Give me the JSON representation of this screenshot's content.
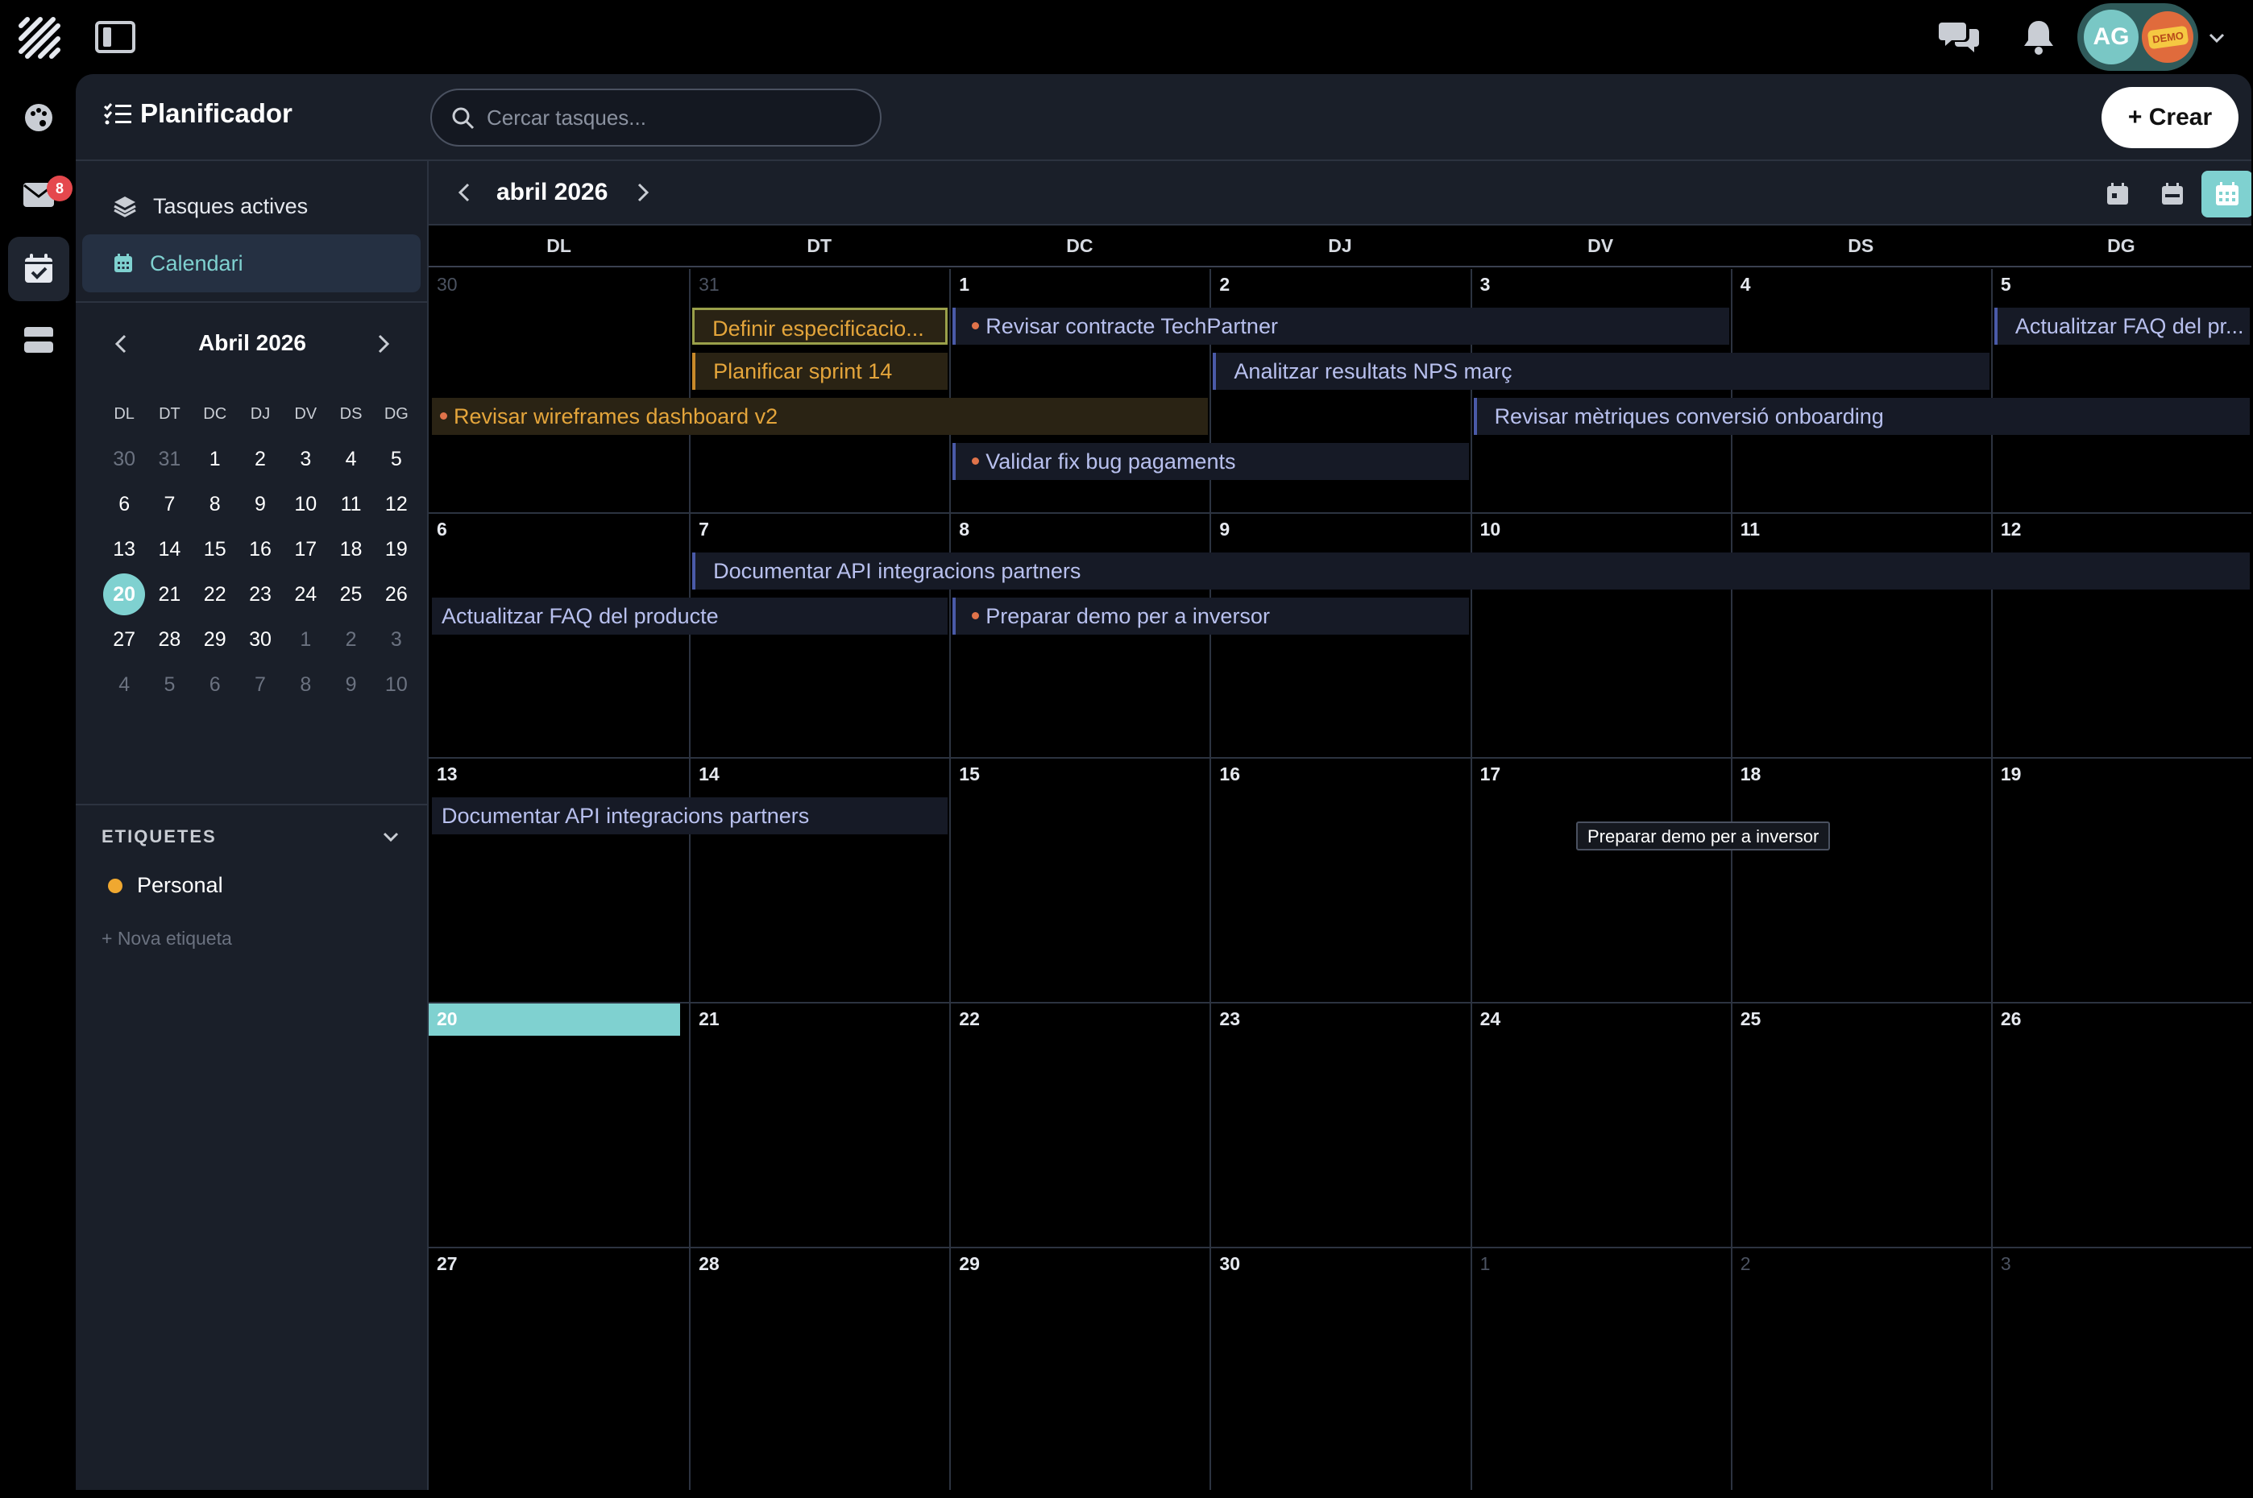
{
  "app": {
    "title": "Planificador",
    "create_label": "+ Crear",
    "user_initials": "AG",
    "demo_label": "DEMO",
    "inbox_badge": "8"
  },
  "search": {
    "placeholder": "Cercar tasques..."
  },
  "sidebar": {
    "items": [
      {
        "label": "Tasques actives",
        "icon": "layers-icon"
      },
      {
        "label": "Calendari",
        "icon": "calendar-icon",
        "active": true
      }
    ]
  },
  "mini_calendar": {
    "title": "Abril 2026",
    "weekdays": [
      "DL",
      "DT",
      "DC",
      "DJ",
      "DV",
      "DS",
      "DG"
    ],
    "weeks": [
      [
        {
          "d": "30",
          "dim": true
        },
        {
          "d": "31",
          "dim": true
        },
        {
          "d": "1"
        },
        {
          "d": "2"
        },
        {
          "d": "3"
        },
        {
          "d": "4"
        },
        {
          "d": "5"
        }
      ],
      [
        {
          "d": "6"
        },
        {
          "d": "7"
        },
        {
          "d": "8"
        },
        {
          "d": "9"
        },
        {
          "d": "10"
        },
        {
          "d": "11"
        },
        {
          "d": "12"
        }
      ],
      [
        {
          "d": "13"
        },
        {
          "d": "14"
        },
        {
          "d": "15"
        },
        {
          "d": "16"
        },
        {
          "d": "17"
        },
        {
          "d": "18"
        },
        {
          "d": "19"
        }
      ],
      [
        {
          "d": "20",
          "today": true
        },
        {
          "d": "21"
        },
        {
          "d": "22"
        },
        {
          "d": "23"
        },
        {
          "d": "24"
        },
        {
          "d": "25"
        },
        {
          "d": "26"
        }
      ],
      [
        {
          "d": "27"
        },
        {
          "d": "28"
        },
        {
          "d": "29"
        },
        {
          "d": "30"
        },
        {
          "d": "1",
          "dim": true
        },
        {
          "d": "2",
          "dim": true
        },
        {
          "d": "3",
          "dim": true
        }
      ],
      [
        {
          "d": "4",
          "dim": true
        },
        {
          "d": "5",
          "dim": true
        },
        {
          "d": "6",
          "dim": true
        },
        {
          "d": "7",
          "dim": true
        },
        {
          "d": "8",
          "dim": true
        },
        {
          "d": "9",
          "dim": true
        },
        {
          "d": "10",
          "dim": true
        }
      ]
    ]
  },
  "tags": {
    "heading": "ETIQUETES",
    "items": [
      {
        "label": "Personal",
        "color": "#f0a830"
      }
    ],
    "new_label": "+ Nova etiqueta"
  },
  "calendar": {
    "title": "abril 2026",
    "weekdays": [
      "DL",
      "DT",
      "DC",
      "DJ",
      "DV",
      "DS",
      "DG"
    ],
    "weeks": [
      [
        "30",
        "31",
        "1",
        "2",
        "3",
        "4",
        "5"
      ],
      [
        "6",
        "7",
        "8",
        "9",
        "10",
        "11",
        "12"
      ],
      [
        "13",
        "14",
        "15",
        "16",
        "17",
        "18",
        "19"
      ],
      [
        "20",
        "21",
        "22",
        "23",
        "24",
        "25",
        "26"
      ],
      [
        "27",
        "28",
        "29",
        "30",
        "1",
        "2",
        "3"
      ]
    ],
    "dim_days": {
      "0": [
        0,
        1
      ],
      "4": [
        4,
        5,
        6
      ]
    },
    "today": {
      "week": 3,
      "day": 0
    },
    "events": [
      {
        "title": "Definir especificacio...",
        "week": 0,
        "start": 1,
        "span": 1,
        "row": 0,
        "style": "orange-sel"
      },
      {
        "title": "Revisar contracte TechPartner",
        "week": 0,
        "start": 2,
        "span": 3,
        "row": 0,
        "style": "blue-dot"
      },
      {
        "title": "Actualitzar FAQ del pr...",
        "week": 0,
        "start": 6,
        "span": 1,
        "row": 0,
        "style": "blue"
      },
      {
        "title": "Planificar sprint 14",
        "week": 0,
        "start": 1,
        "span": 1,
        "row": 1,
        "style": "orange"
      },
      {
        "title": "Analitzar resultats NPS març",
        "week": 0,
        "start": 3,
        "span": 3,
        "row": 1,
        "style": "blue"
      },
      {
        "title": "Revisar wireframes dashboard v2",
        "week": 0,
        "start": 0,
        "span": 3,
        "row": 2,
        "style": "orange-dot"
      },
      {
        "title": "Revisar mètriques conversió onboarding",
        "week": 0,
        "start": 4,
        "span": 3,
        "row": 2,
        "style": "blue"
      },
      {
        "title": "Validar fix bug pagaments",
        "week": 0,
        "start": 2,
        "span": 2,
        "row": 3,
        "style": "blue-dot"
      },
      {
        "title": "Documentar API integracions partners",
        "week": 1,
        "start": 1,
        "span": 6,
        "row": 0,
        "style": "blue"
      },
      {
        "title": "Actualitzar FAQ del producte",
        "week": 1,
        "start": 0,
        "span": 2,
        "row": 1,
        "style": "blue-plain"
      },
      {
        "title": "Preparar demo per a inversor",
        "week": 1,
        "start": 2,
        "span": 2,
        "row": 1,
        "style": "blue-dot"
      },
      {
        "title": "Documentar API integracions partners",
        "week": 2,
        "start": 0,
        "span": 2,
        "row": 0,
        "style": "blue-plain"
      }
    ],
    "tooltip": "Preparar demo per a inversor"
  }
}
